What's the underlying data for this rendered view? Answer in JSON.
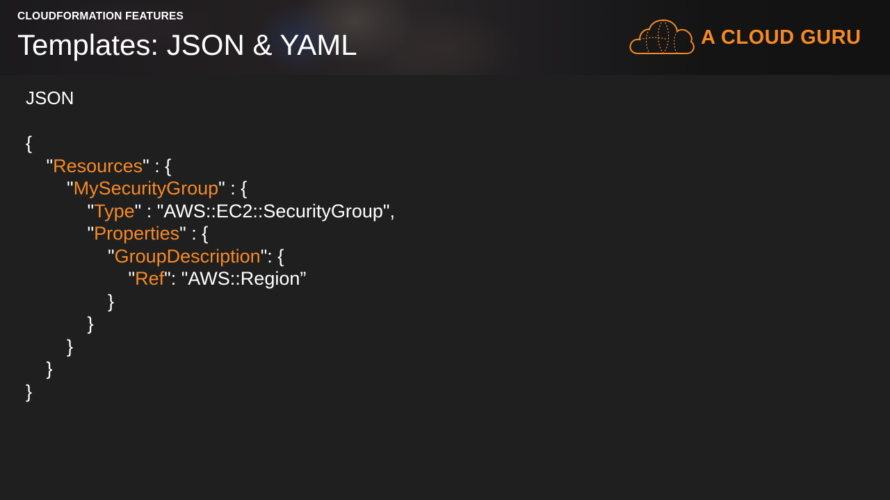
{
  "header": {
    "kicker": "CLOUDFORMATION FEATURES",
    "title": "Templates: JSON & YAML",
    "logo_text": "A CLOUD GURU"
  },
  "section_label": "JSON",
  "code": {
    "lines": [
      {
        "indent": 0,
        "parts": [
          {
            "t": "{",
            "k": false
          }
        ]
      },
      {
        "indent": 1,
        "parts": [
          {
            "t": "\"",
            "k": false
          },
          {
            "t": "Resources",
            "k": true
          },
          {
            "t": "\" : {",
            "k": false
          }
        ]
      },
      {
        "indent": 2,
        "parts": [
          {
            "t": "\"",
            "k": false
          },
          {
            "t": "MySecurityGroup",
            "k": true
          },
          {
            "t": "\" : {",
            "k": false
          }
        ]
      },
      {
        "indent": 3,
        "parts": [
          {
            "t": "\"",
            "k": false
          },
          {
            "t": "Type",
            "k": true
          },
          {
            "t": "\" : \"AWS::EC2::SecurityGroup\",",
            "k": false
          }
        ]
      },
      {
        "indent": 3,
        "parts": [
          {
            "t": "\"",
            "k": false
          },
          {
            "t": "Properties",
            "k": true
          },
          {
            "t": "\" : {",
            "k": false
          }
        ]
      },
      {
        "indent": 4,
        "parts": [
          {
            "t": "\"",
            "k": false
          },
          {
            "t": "GroupDescription",
            "k": true
          },
          {
            "t": "\": {",
            "k": false
          }
        ]
      },
      {
        "indent": 5,
        "parts": [
          {
            "t": "\"",
            "k": false
          },
          {
            "t": "Ref",
            "k": true
          },
          {
            "t": "\": \"AWS::Region”",
            "k": false
          }
        ]
      },
      {
        "indent": 4,
        "parts": [
          {
            "t": "}",
            "k": false
          }
        ]
      },
      {
        "indent": 3,
        "parts": [
          {
            "t": "}",
            "k": false
          }
        ]
      },
      {
        "indent": 2,
        "parts": [
          {
            "t": "}",
            "k": false
          }
        ]
      },
      {
        "indent": 1,
        "parts": [
          {
            "t": "}",
            "k": false
          }
        ]
      },
      {
        "indent": 0,
        "parts": [
          {
            "t": "}",
            "k": false
          }
        ]
      }
    ]
  },
  "colors": {
    "accent": "#f58a26",
    "background": "#1f1f1f",
    "text": "#ffffff"
  },
  "icons": [
    "cloud-logo-icon"
  ]
}
